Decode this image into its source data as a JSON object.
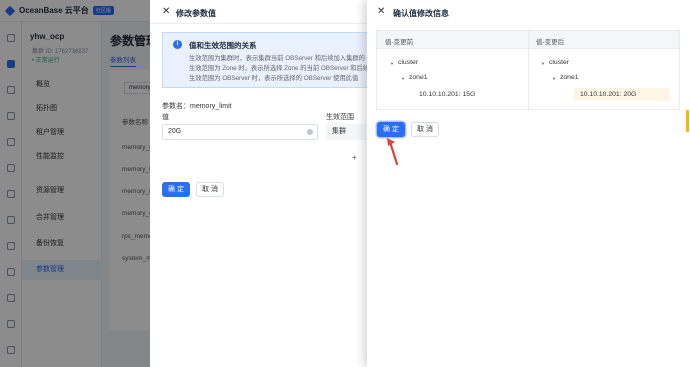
{
  "topbar": {
    "brand": "OceanBase 云平台",
    "tag": "社区版"
  },
  "sidepanel": {
    "tenant_name": "yhw_ocp",
    "tenant_id": "集群 ID: 1762736837",
    "tenant_status": "• 正常运行",
    "items": [
      {
        "label": "概览"
      },
      {
        "label": "拓扑图"
      },
      {
        "label": "租户管理"
      },
      {
        "label": "性能监控"
      },
      {
        "label": "资源管理"
      },
      {
        "label": "合并管理"
      },
      {
        "label": "备份恢复"
      },
      {
        "label": "参数管理",
        "active": true
      }
    ]
  },
  "main": {
    "title": "参数管理",
    "tab": "参数列表",
    "search_value": "memory",
    "col_header": "参数名称",
    "rows": [
      "memory_c",
      "memory_l",
      "memory_l",
      "memory_r",
      "rpc_memo",
      "system_m"
    ]
  },
  "drawer1": {
    "title": "修改参数值",
    "alert_title": "值和生效范围的关系",
    "alert_lines": [
      "生效范围为集群时，表示集群当前 OBServer 和后续加入集群的 OBServer 使用此值",
      "生效范围为 Zone 时，表示所选择 Zone 的当前 OBServer 和后续加入此 Zone 的 OBServer 使用此值",
      "生效范围为 OBServer 时，表示所选择的 OBServer 使用此值"
    ],
    "param_name_label": "参数名：memory_limit",
    "col_value": "值",
    "col_scope": "生效范围",
    "value_input": "20G",
    "scope_value": "集群",
    "plus": "+",
    "ok": "确 定",
    "cancel": "取 消"
  },
  "drawer2": {
    "title": "确认值修改信息",
    "col_before": "值-变更前",
    "col_after": "值-变更后",
    "before": {
      "cluster": "cluster",
      "zone": "zone1",
      "leaf": "10.10.10.201: 15G"
    },
    "after": {
      "cluster": "cluster",
      "zone": "zone1",
      "leaf": "10.10.10.201: 20G"
    },
    "ok": "确 定",
    "cancel": "取 消"
  },
  "colors": {
    "primary": "#2a6ef2",
    "changed_bg": "#fdf5e5",
    "arrow": "#e0413a"
  },
  "icons": [
    "close-icon",
    "info-icon",
    "triangle-down-icon",
    "clear-icon",
    "plus-icon",
    "arrow-annotation-icon"
  ]
}
